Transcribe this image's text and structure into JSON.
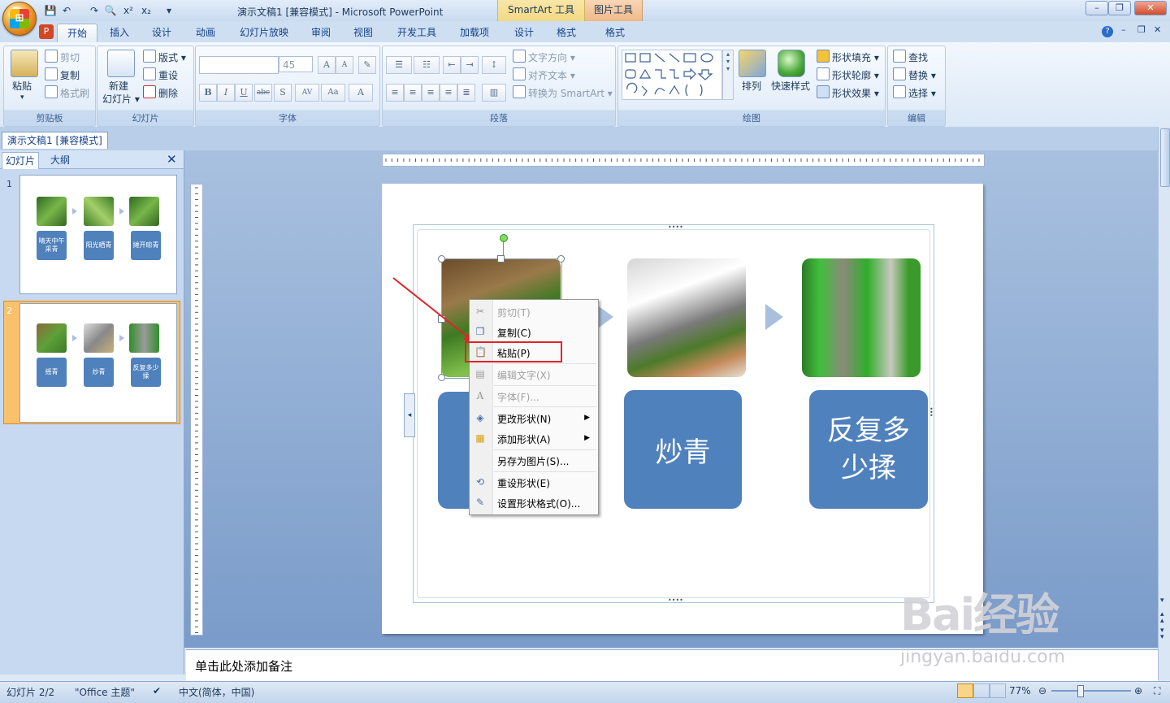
{
  "window": {
    "title": "演示文稿1 [兼容模式] - Microsoft PowerPoint",
    "context_tabs": [
      "SmartArt 工具",
      "图片工具"
    ]
  },
  "ribbon": {
    "tabs": [
      "开始",
      "插入",
      "设计",
      "动画",
      "幻灯片放映",
      "审阅",
      "视图",
      "开发工具",
      "加载项",
      "设计",
      "格式",
      "格式"
    ],
    "active_tab": 0,
    "clipboard": {
      "label": "剪贴板",
      "paste": "粘贴",
      "cut": "剪切",
      "copy": "复制",
      "format_painter": "格式刷"
    },
    "slides": {
      "label": "幻灯片",
      "new_slide": "新建",
      "new_slide2": "幻灯片",
      "layout": "版式",
      "reset": "重设",
      "delete": "删除"
    },
    "font": {
      "label": "字体",
      "size": "45"
    },
    "paragraph": {
      "label": "段落",
      "text_direction": "文字方向",
      "align_text": "对齐文本",
      "convert_smartart": "转换为 SmartArt"
    },
    "drawing": {
      "label": "绘图",
      "arrange": "排列",
      "quick_styles": "快速样式",
      "shape_fill": "形状填充",
      "shape_outline": "形状轮廓",
      "shape_effects": "形状效果"
    },
    "editing": {
      "label": "编辑",
      "find": "查找",
      "replace": "替换",
      "select": "选择"
    }
  },
  "doc_tab": "演示文稿1 [兼容模式]",
  "left_pane": {
    "tabs": [
      "幻灯片",
      "大纲"
    ],
    "thumbnails": [
      {
        "num": "1",
        "labels": [
          "晴天中午采青",
          "阳光晒青",
          "摊开晾青"
        ]
      },
      {
        "num": "2",
        "labels": [
          "摇青",
          "炒青",
          "反复多少揉"
        ]
      }
    ]
  },
  "slide": {
    "shapes": [
      "炒青",
      "反复多少揉"
    ]
  },
  "context_menu": {
    "items": [
      "剪切(T)",
      "复制(C)",
      "粘贴(P)",
      "编辑文字(X)",
      "字体(F)...",
      "更改形状(N)",
      "添加形状(A)",
      "另存为图片(S)...",
      "重设形状(E)",
      "设置形状格式(O)..."
    ]
  },
  "notes": {
    "placeholder": "单击此处添加备注"
  },
  "status": {
    "slide": "幻灯片 2/2",
    "theme": "\"Office 主题\"",
    "language": "中文(简体，中国)",
    "zoom": "77%"
  },
  "watermark": {
    "main": "Bai经验",
    "url": "jingyan.baidu.com"
  }
}
